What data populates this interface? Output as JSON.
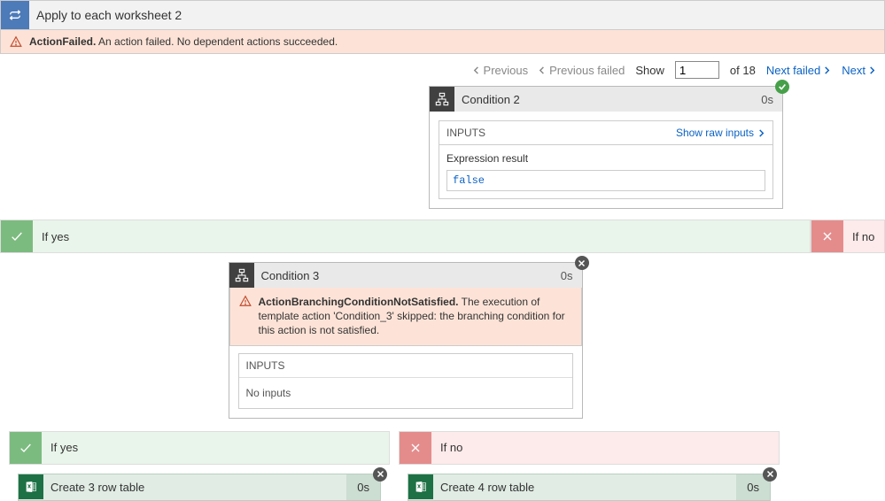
{
  "header": {
    "title": "Apply to each worksheet 2",
    "error_bold": "ActionFailed.",
    "error_rest": " An action failed. No dependent actions succeeded."
  },
  "pager": {
    "previous": "Previous",
    "previous_failed": "Previous failed",
    "show": "Show",
    "value": "1",
    "of": "of 18",
    "next_failed": "Next failed",
    "next": "Next"
  },
  "cond2": {
    "title": "Condition 2",
    "duration": "0s",
    "inputs_label": "INPUTS",
    "show_raw": "Show raw inputs",
    "expr_label": "Expression result",
    "expr_value": "false"
  },
  "branches": {
    "yes": "If yes",
    "no": "If no"
  },
  "cond3": {
    "title": "Condition 3",
    "duration": "0s",
    "err_bold": "ActionBranchingConditionNotSatisfied.",
    "err_rest": " The execution of template action 'Condition_3' skipped: the branching condition for this action is not satisfied.",
    "inputs_label": "INPUTS",
    "no_inputs": "No inputs"
  },
  "excel1": {
    "title": "Create 3 row table",
    "duration": "0s"
  },
  "excel2": {
    "title": "Create 4 row table",
    "duration": "0s"
  },
  "inner_branches": {
    "yes": "If yes",
    "no": "If no"
  }
}
